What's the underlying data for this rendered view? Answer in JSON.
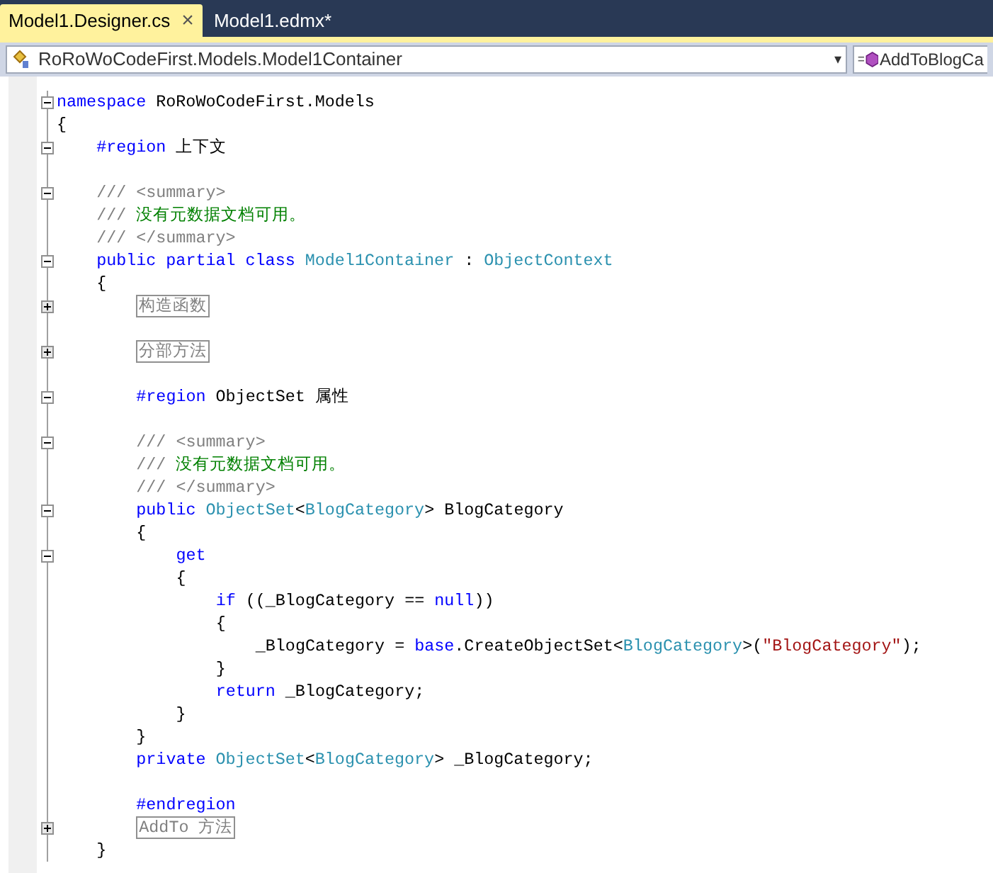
{
  "tabs": [
    {
      "label": "Model1.Designer.cs",
      "selected": true,
      "close": "×"
    },
    {
      "label": "Model1.edmx*",
      "selected": false
    }
  ],
  "navigation": [
    {
      "kind": "type",
      "text": "RoRoWoCodeFirst.Models.Model1Container",
      "arrow": "▾"
    },
    {
      "kind": "member",
      "text": "AddToBlogCa"
    }
  ],
  "code": [
    {
      "kind": "code",
      "expanded": true,
      "tokens": [
        {
          "kind": "keyword",
          "text": "namespace"
        },
        {
          "kind": "plain",
          "text": " RoRoWoCodeFirst.Models"
        }
      ]
    },
    {
      "kind": "code",
      "tokens": [
        {
          "kind": "plain",
          "text": "{"
        }
      ],
      "children": [
        {
          "kind": "code",
          "expanded": true,
          "tokens": [
            {
              "kind": "keyword",
              "text": "#region"
            },
            {
              "kind": "plain",
              "text": " 上下文"
            }
          ]
        },
        {
          "kind": "blank"
        },
        {
          "kind": "code",
          "expanded": true,
          "tokens": [
            {
              "kind": "doc",
              "text": "/// <summary>"
            }
          ]
        },
        {
          "kind": "code",
          "tokens": [
            {
              "kind": "doc",
              "text": "/// "
            },
            {
              "kind": "comment",
              "text": "没有元数据文档可用。"
            }
          ]
        },
        {
          "kind": "code",
          "tokens": [
            {
              "kind": "doc",
              "text": "/// </summary>"
            }
          ]
        },
        {
          "kind": "code",
          "expanded": true,
          "tokens": [
            {
              "kind": "keyword",
              "text": "public partial class "
            },
            {
              "kind": "type",
              "text": "Model1Container"
            },
            {
              "kind": "plain",
              "text": " : "
            },
            {
              "kind": "type",
              "text": "ObjectContext"
            }
          ]
        },
        {
          "kind": "code",
          "tokens": [
            {
              "kind": "plain",
              "text": "{"
            }
          ],
          "children": [
            {
              "kind": "collapsed",
              "expanded": false,
              "text": "构造函数"
            },
            {
              "kind": "blank"
            },
            {
              "kind": "collapsed",
              "expanded": false,
              "text": "分部方法"
            },
            {
              "kind": "blank"
            },
            {
              "kind": "code",
              "expanded": true,
              "tokens": [
                {
                  "kind": "keyword",
                  "text": "#region"
                },
                {
                  "kind": "plain",
                  "text": " ObjectSet 属性"
                }
              ]
            },
            {
              "kind": "blank"
            },
            {
              "kind": "code",
              "expanded": true,
              "tokens": [
                {
                  "kind": "doc",
                  "text": "/// <summary>"
                }
              ]
            },
            {
              "kind": "code",
              "tokens": [
                {
                  "kind": "doc",
                  "text": "/// "
                },
                {
                  "kind": "comment",
                  "text": "没有元数据文档可用。"
                }
              ]
            },
            {
              "kind": "code",
              "tokens": [
                {
                  "kind": "doc",
                  "text": "/// </summary>"
                }
              ]
            },
            {
              "kind": "code",
              "expanded": true,
              "tokens": [
                {
                  "kind": "keyword",
                  "text": "public "
                },
                {
                  "kind": "type",
                  "text": "ObjectSet"
                },
                {
                  "kind": "plain",
                  "text": "<"
                },
                {
                  "kind": "type",
                  "text": "BlogCategory"
                },
                {
                  "kind": "plain",
                  "text": "> BlogCategory"
                }
              ]
            },
            {
              "kind": "code",
              "tokens": [
                {
                  "kind": "plain",
                  "text": "{"
                }
              ],
              "children": [
                {
                  "kind": "code",
                  "expanded": true,
                  "tokens": [
                    {
                      "kind": "keyword",
                      "text": "get"
                    }
                  ]
                },
                {
                  "kind": "code",
                  "tokens": [
                    {
                      "kind": "plain",
                      "text": "{"
                    }
                  ],
                  "children": [
                    {
                      "kind": "code",
                      "tokens": [
                        {
                          "kind": "keyword",
                          "text": "if"
                        },
                        {
                          "kind": "plain",
                          "text": " ((_BlogCategory == "
                        },
                        {
                          "kind": "keyword",
                          "text": "null"
                        },
                        {
                          "kind": "plain",
                          "text": "))"
                        }
                      ]
                    },
                    {
                      "kind": "code",
                      "tokens": [
                        {
                          "kind": "plain",
                          "text": "{"
                        }
                      ],
                      "children": [
                        {
                          "kind": "code",
                          "tokens": [
                            {
                              "kind": "plain",
                              "text": "_BlogCategory = "
                            },
                            {
                              "kind": "keyword",
                              "text": "base"
                            },
                            {
                              "kind": "plain",
                              "text": ".CreateObjectSet<"
                            },
                            {
                              "kind": "type",
                              "text": "BlogCategory"
                            },
                            {
                              "kind": "plain",
                              "text": ">("
                            },
                            {
                              "kind": "string",
                              "text": "\"BlogCategory\""
                            },
                            {
                              "kind": "plain",
                              "text": ");"
                            }
                          ]
                        }
                      ]
                    },
                    {
                      "kind": "code",
                      "tokens": [
                        {
                          "kind": "plain",
                          "text": "}"
                        }
                      ]
                    },
                    {
                      "kind": "code",
                      "tokens": [
                        {
                          "kind": "keyword",
                          "text": "return"
                        },
                        {
                          "kind": "plain",
                          "text": " _BlogCategory;"
                        }
                      ]
                    }
                  ]
                },
                {
                  "kind": "code",
                  "tokens": [
                    {
                      "kind": "plain",
                      "text": "}"
                    }
                  ]
                }
              ]
            },
            {
              "kind": "code",
              "tokens": [
                {
                  "kind": "plain",
                  "text": "}"
                }
              ]
            },
            {
              "kind": "code",
              "tokens": [
                {
                  "kind": "keyword",
                  "text": "private "
                },
                {
                  "kind": "type",
                  "text": "ObjectSet"
                },
                {
                  "kind": "plain",
                  "text": "<"
                },
                {
                  "kind": "type",
                  "text": "BlogCategory"
                },
                {
                  "kind": "plain",
                  "text": "> _BlogCategory;"
                }
              ]
            },
            {
              "kind": "blank"
            },
            {
              "kind": "code",
              "tokens": [
                {
                  "kind": "keyword",
                  "text": "#endregion"
                }
              ]
            },
            {
              "kind": "collapsed",
              "expanded": false,
              "text": "AddTo 方法"
            }
          ]
        },
        {
          "kind": "code",
          "tokens": [
            {
              "kind": "plain",
              "text": "}"
            }
          ]
        }
      ]
    }
  ]
}
